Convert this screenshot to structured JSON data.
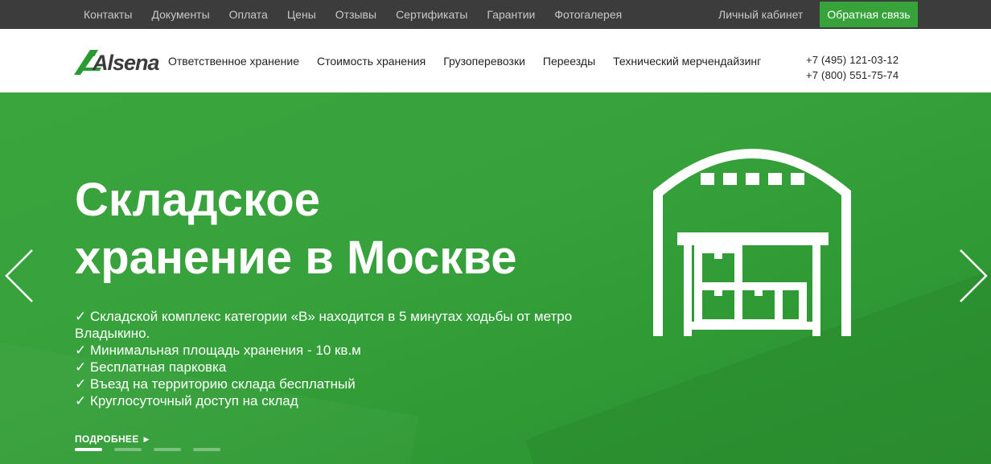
{
  "topbar": {
    "links": [
      "Контакты",
      "Документы",
      "Оплата",
      "Цены",
      "Отзывы",
      "Сертификаты",
      "Гарантии",
      "Фотогалерея"
    ],
    "cabinet": "Личный кабинет",
    "callback": "Обратная связь"
  },
  "header": {
    "logo_text": "Alsena",
    "nav": [
      "Ответственное хранение",
      "Стоимость хранения",
      "Грузоперевозки",
      "Переезды",
      "Технический мерчендайзинг"
    ],
    "phones": [
      "+7 (495) 121-03-12",
      "+7 (800) 551-75-74"
    ]
  },
  "hero": {
    "title_line1": "Складское",
    "title_line2": "хранение в Москве",
    "features": [
      "✓ Складской комплекс категории «В» находится в 5 минутах ходьбы от метро Владыкино.",
      "✓ Минимальная площадь хранения - 10 кв.м",
      "✓ Бесплатная парковка",
      "✓ Въезд на территорию склада бесплатный",
      "✓ Круглосуточный доступ на склад"
    ],
    "more": "ПОДРОБНЕЕ",
    "slides_total": 4,
    "active_slide": 1
  },
  "colors": {
    "topbar_bg": "#3c3c3c",
    "accent_green": "#37a23a",
    "hero_green": "#33a037"
  }
}
